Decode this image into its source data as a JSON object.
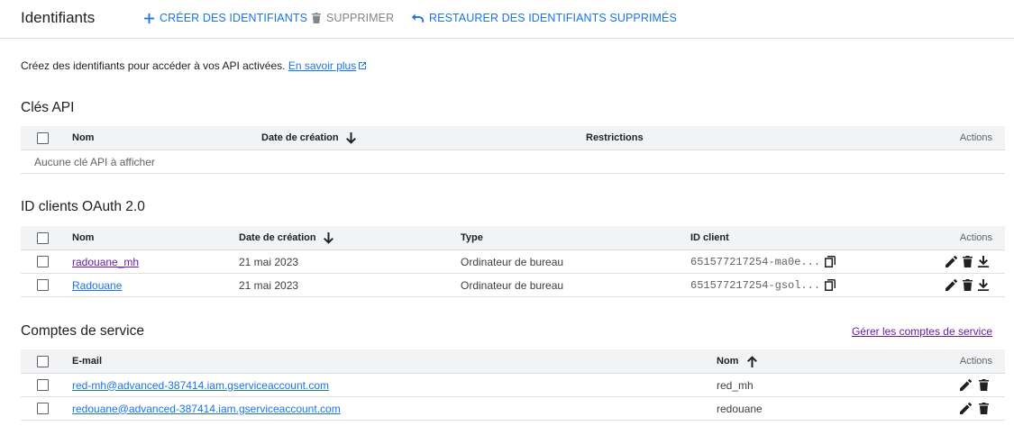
{
  "header": {
    "title": "Identifiants",
    "create_label": "CRÉER DES IDENTIFIANTS",
    "delete_label": "SUPPRIMER",
    "restore_label": "RESTAURER DES IDENTIFIANTS SUPPRIMÉS"
  },
  "intro": {
    "text": "Créez des identifiants pour accéder à vos API activées.",
    "link": "En savoir plus"
  },
  "api_keys": {
    "title": "Clés API",
    "headers": {
      "name": "Nom",
      "created": "Date de création",
      "restrictions": "Restrictions",
      "actions": "Actions"
    },
    "empty": "Aucune clé API à afficher"
  },
  "oauth": {
    "title": "ID clients OAuth 2.0",
    "headers": {
      "name": "Nom",
      "created": "Date de création",
      "type": "Type",
      "client_id": "ID client",
      "actions": "Actions"
    },
    "rows": [
      {
        "name": "radouane_mh",
        "created": "21 mai 2023",
        "type": "Ordinateur de bureau",
        "client_id": "651577217254-ma0e..."
      },
      {
        "name": "Radouane",
        "created": "21 mai 2023",
        "type": "Ordinateur de bureau",
        "client_id": "651577217254-gsol..."
      }
    ]
  },
  "service_accounts": {
    "title": "Comptes de service",
    "manage_link": "Gérer les comptes de service",
    "headers": {
      "email": "E-mail",
      "name": "Nom",
      "actions": "Actions"
    },
    "rows": [
      {
        "email": "red-mh@advanced-387414.iam.gserviceaccount.com",
        "name": "red_mh"
      },
      {
        "email": "redouane@advanced-387414.iam.gserviceaccount.com",
        "name": "redouane"
      }
    ]
  },
  "colors": {
    "accent": "#1a73e8",
    "visited": "#681da8",
    "header_bg": "#f1f3f4"
  }
}
